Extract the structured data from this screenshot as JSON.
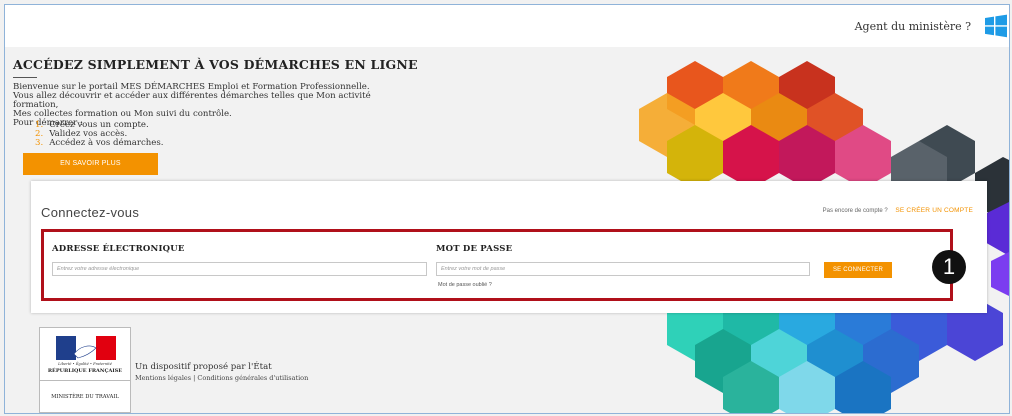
{
  "header": {
    "agent_link": "Agent du ministère ?",
    "brand_icon": "windows-logo-icon",
    "brand_color": "#1e9be6"
  },
  "hero": {
    "title": "ACCÉDEZ SIMPLEMENT À VOS DÉMARCHES EN LIGNE",
    "intro_lines": [
      "Bienvenue sur le portail MES DÉMARCHES Emploi et Formation Professionnelle.",
      "Vous allez découvrir et accéder aux différentes démarches telles que Mon activité formation,",
      "Mes collectes formation ou Mon suivi du contrôle.",
      "Pour démarrer :"
    ],
    "steps": [
      {
        "num": "1.",
        "text": "Créez vous un compte."
      },
      {
        "num": "2.",
        "text": "Validez vos accès."
      },
      {
        "num": "3.",
        "text": "Accédez à vos démarches."
      }
    ],
    "more_button": "EN SAVOIR PLUS"
  },
  "login": {
    "title": "Connectez-vous",
    "no_account": "Pas encore de compte ?",
    "create_account": "SE CRÉER UN COMPTE",
    "email_label": "ADRESSE ÉLECTRONIQUE",
    "email_placeholder": "Entrez votre adresse électronique",
    "email_value": "",
    "password_label": "MOT DE PASSE",
    "password_placeholder": "Entrez votre mot de passe",
    "password_value": "",
    "forgot": "Mot de passe oublié ?",
    "submit": "SE CONNECTER",
    "callout_number": "1"
  },
  "footer": {
    "logo_motto": "Liberté • Égalité • Fraternité",
    "logo_republic": "RÉPUBLIQUE FRANÇAISE",
    "logo_ministry": "MINISTÈRE DU TRAVAIL",
    "tagline": "Un dispositif proposé par l'État",
    "legal": "Mentions légales | Conditions générales d'utilisation"
  },
  "colors": {
    "accent": "#f39200",
    "highlight_border": "#b0101a"
  }
}
